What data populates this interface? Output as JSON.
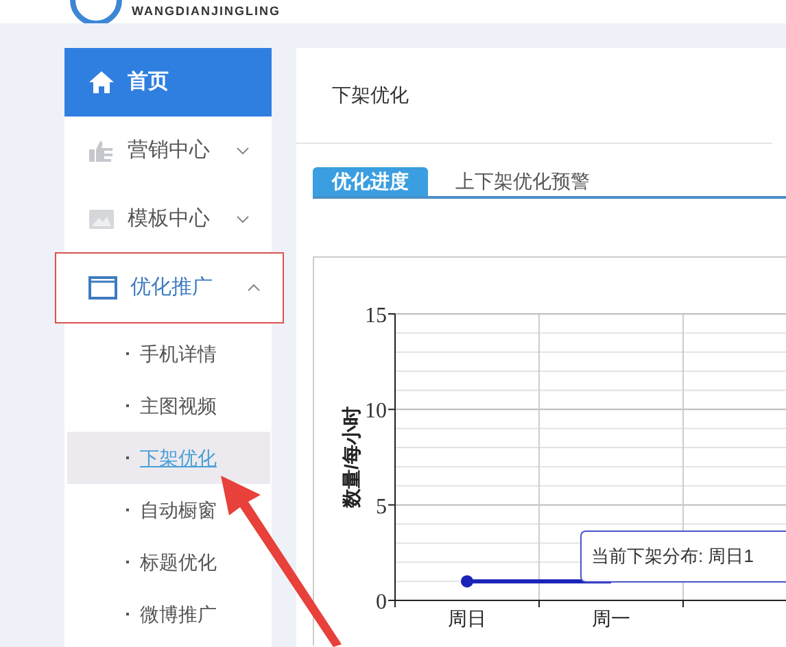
{
  "header": {
    "logo_text": "WANGDIANJINGLING"
  },
  "sidebar": {
    "items": [
      {
        "label": "首页",
        "selected": true
      },
      {
        "label": "营销中心",
        "selected": false,
        "expanded": false
      },
      {
        "label": "模板中心",
        "selected": false,
        "expanded": false
      },
      {
        "label": "优化推广",
        "selected": false,
        "expanded": true,
        "highlighted": true,
        "children": [
          {
            "label": "手机详情",
            "selected": false
          },
          {
            "label": "主图视频",
            "selected": false
          },
          {
            "label": "下架优化",
            "selected": true
          },
          {
            "label": "自动橱窗",
            "selected": false
          },
          {
            "label": "标题优化",
            "selected": false
          },
          {
            "label": "微博推广",
            "selected": false
          }
        ]
      }
    ]
  },
  "main": {
    "title": "下架优化",
    "tabs": [
      {
        "label": "优化进度",
        "selected": true
      },
      {
        "label": "上下架优化预警",
        "selected": false
      }
    ],
    "chart_data": {
      "type": "line",
      "ylabel": "数量/每小时",
      "categories": [
        "周日",
        "周一"
      ],
      "series": [
        {
          "color": "#1a23b8",
          "values": [
            1,
            1
          ]
        }
      ],
      "ylim": [
        0,
        15
      ],
      "yticks": [
        0,
        5,
        10,
        15
      ]
    },
    "tooltip": "当前下架分布: 周日1"
  }
}
